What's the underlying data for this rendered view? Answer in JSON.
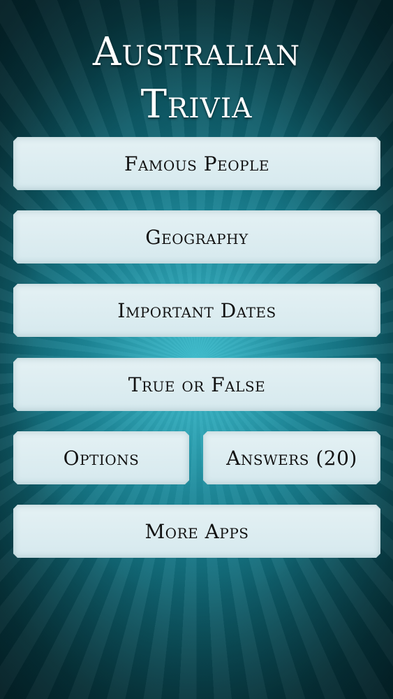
{
  "app": {
    "title_line1": "Australian",
    "title_line2": "Trivia"
  },
  "menu": {
    "famous_people": "Famous People",
    "geography": "Geography",
    "important_dates": "Important Dates",
    "true_or_false": "True or False",
    "options": "Options",
    "answers": "Answers (20)",
    "more_apps": "More Apps"
  },
  "colors": {
    "background": "#13707f",
    "button_fill": "#dcedf1",
    "button_text": "#121212",
    "title_text": "#ffffff"
  }
}
